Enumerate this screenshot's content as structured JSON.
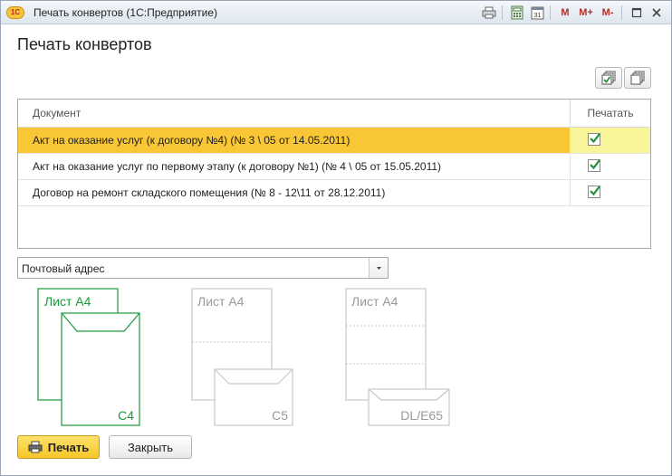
{
  "window": {
    "title": "Печать конвертов (1С:Предприятие)",
    "logo_text": "1С",
    "toolbar_icons": [
      "print-icon",
      "calculator-icon",
      "calendar-icon"
    ],
    "calendar_day": "31",
    "memory_buttons": [
      "M",
      "M+",
      "M-"
    ]
  },
  "form": {
    "title": "Печать конвертов"
  },
  "table": {
    "columns": [
      "Документ",
      "Печатать"
    ],
    "rows": [
      {
        "document": "Акт на оказание услуг (к договору №4) (№ 3 \\ 05 от 14.05.2011)",
        "print": true,
        "selected": true
      },
      {
        "document": "Акт на оказание услуг по первому этапу (к договору №1) (№ 4 \\ 05 от 15.05.2011)",
        "print": true,
        "selected": false
      },
      {
        "document": "Договор на ремонт складского помещения (№ 8 - 12\\11 от 28.12.2011)",
        "print": true,
        "selected": false
      }
    ]
  },
  "address_select": {
    "value": "Почтовый адрес"
  },
  "envelopes": [
    {
      "sheet_label": "Лист A4",
      "format": "C4",
      "selected": true
    },
    {
      "sheet_label": "Лист A4",
      "format": "C5",
      "selected": false
    },
    {
      "sheet_label": "Лист A4",
      "format": "DL/E65",
      "selected": false
    }
  ],
  "colors": {
    "selected_row": "#f9c635",
    "selected_check_cell": "#f8f49a",
    "check_mark": "#1e8f3a",
    "envelope_selected": "#1a9a3a",
    "envelope_inactive": "#c8c8c8"
  },
  "buttons": {
    "print_label": "Печать",
    "close_label": "Закрыть"
  }
}
